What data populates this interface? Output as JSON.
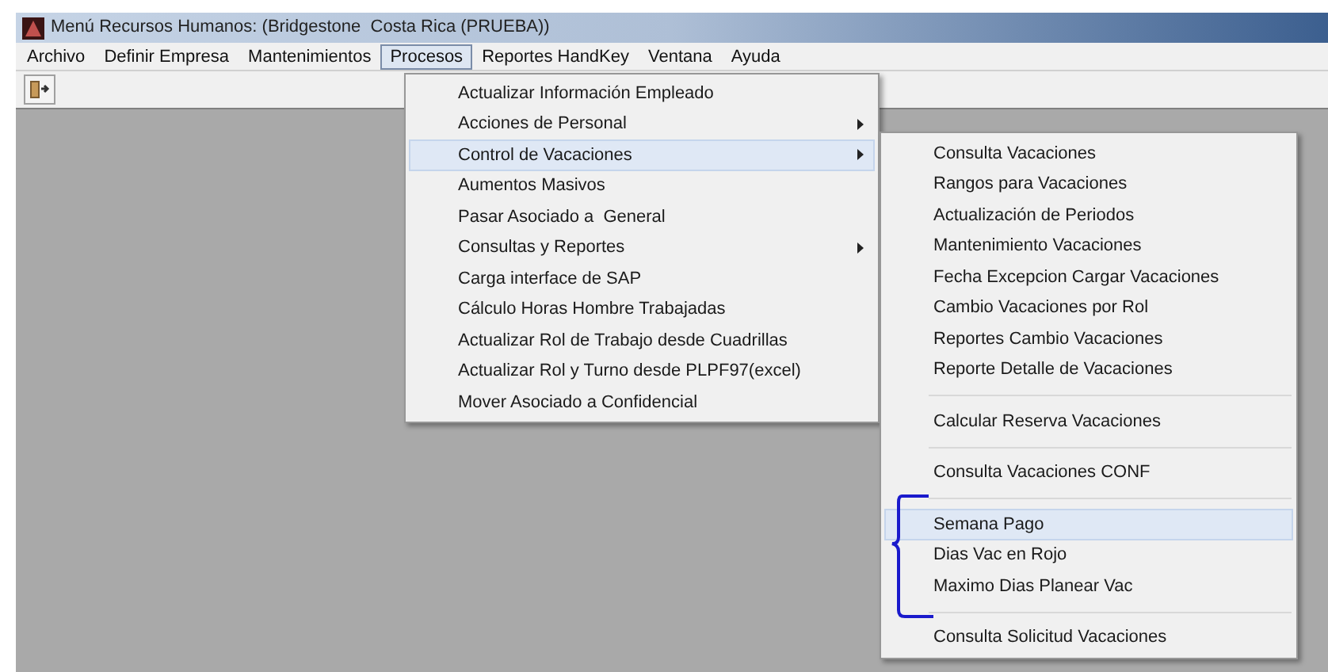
{
  "window": {
    "title": "Menú Recursos Humanos: (Bridgestone  Costa Rica (PRUEBA))"
  },
  "menu_bar": [
    {
      "label": "Archivo",
      "selected": false
    },
    {
      "label": "Definir Empresa",
      "selected": false
    },
    {
      "label": "Mantenimientos",
      "selected": false
    },
    {
      "label": "Procesos",
      "selected": true
    },
    {
      "label": "Reportes HandKey",
      "selected": false
    },
    {
      "label": "Ventana",
      "selected": false
    },
    {
      "label": "Ayuda",
      "selected": false
    }
  ],
  "procesos_menu": [
    {
      "kind": "item",
      "label": "Actualizar Información Empleado",
      "selected": false,
      "submenu": false
    },
    {
      "kind": "item",
      "label": "Acciones de Personal",
      "selected": false,
      "submenu": true
    },
    {
      "kind": "item",
      "label": "Control de Vacaciones",
      "selected": true,
      "submenu": true
    },
    {
      "kind": "item",
      "label": "Aumentos Masivos",
      "selected": false,
      "submenu": false
    },
    {
      "kind": "item",
      "label": "Pasar Asociado a  General",
      "selected": false,
      "submenu": false
    },
    {
      "kind": "item",
      "label": "Consultas y Reportes",
      "selected": false,
      "submenu": true
    },
    {
      "kind": "item",
      "label": "Carga interface de SAP",
      "selected": false,
      "submenu": false
    },
    {
      "kind": "item",
      "label": "Cálculo Horas Hombre Trabajadas",
      "selected": false,
      "submenu": false
    },
    {
      "kind": "item",
      "label": "Actualizar Rol de Trabajo desde Cuadrillas",
      "selected": false,
      "submenu": false
    },
    {
      "kind": "item",
      "label": "Actualizar Rol y Turno desde PLPF97(excel)",
      "selected": false,
      "submenu": false
    },
    {
      "kind": "item",
      "label": "Mover Asociado a Confidencial",
      "selected": false,
      "submenu": false
    }
  ],
  "vacaciones_submenu": [
    {
      "kind": "item",
      "label": "Consulta Vacaciones",
      "selected": false
    },
    {
      "kind": "item",
      "label": "Rangos para Vacaciones",
      "selected": false
    },
    {
      "kind": "item",
      "label": "Actualización de Periodos",
      "selected": false
    },
    {
      "kind": "item",
      "label": "Mantenimiento Vacaciones",
      "selected": false
    },
    {
      "kind": "item",
      "label": "Fecha Excepcion Cargar Vacaciones",
      "selected": false
    },
    {
      "kind": "item",
      "label": "Cambio Vacaciones por Rol",
      "selected": false
    },
    {
      "kind": "item",
      "label": "Reportes Cambio Vacaciones",
      "selected": false
    },
    {
      "kind": "item",
      "label": "Reporte Detalle de Vacaciones",
      "selected": false
    },
    {
      "kind": "separator"
    },
    {
      "kind": "item",
      "label": "Calcular Reserva Vacaciones",
      "selected": false
    },
    {
      "kind": "separator"
    },
    {
      "kind": "item",
      "label": "Consulta Vacaciones CONF",
      "selected": false
    },
    {
      "kind": "separator"
    },
    {
      "kind": "item",
      "label": "Semana Pago",
      "selected": true
    },
    {
      "kind": "item",
      "label": "Dias Vac en Rojo",
      "selected": false
    },
    {
      "kind": "item",
      "label": "Maximo Dias Planear Vac",
      "selected": false
    },
    {
      "kind": "separator"
    },
    {
      "kind": "item",
      "label": "Consulta Solicitud Vacaciones",
      "selected": false
    }
  ]
}
